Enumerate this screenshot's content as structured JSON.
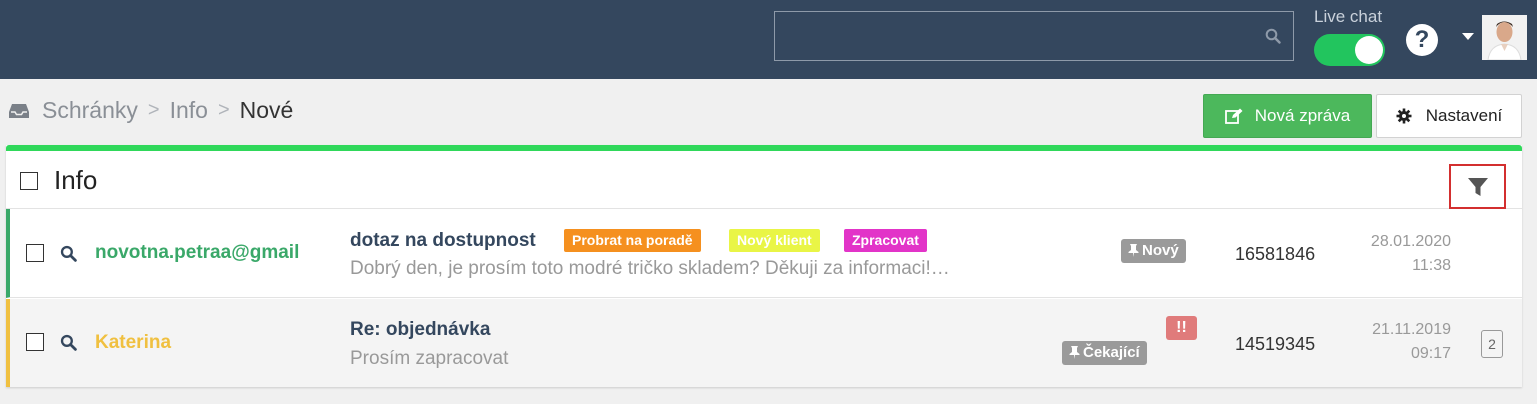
{
  "header": {
    "search_placeholder": "",
    "live_chat_label": "Live chat",
    "live_chat_on": true,
    "help_label": "?"
  },
  "breadcrumb": [
    "Schránky",
    "Info",
    "Nové"
  ],
  "toolbar": {
    "new_message_label": "Nová zpráva",
    "settings_label": "Nastavení"
  },
  "panel": {
    "title": "Info"
  },
  "messages": [
    {
      "sender": "novotna.petraa@gmail",
      "subject": "dotaz na dostupnost",
      "preview": "Dobrý den, je prosím toto modré tričko skladem?  Děkuji za informaci!…",
      "tags": [
        {
          "label": "Probrat na poradě",
          "color": "#f5901f"
        },
        {
          "label": "Nový klient",
          "color": "#e9f546"
        },
        {
          "label": "Zpracovat",
          "color": "#e234c8"
        }
      ],
      "status": "Nový",
      "id": "16581846",
      "date": "28.01.2020",
      "time": "11:38",
      "sender_color": "#3aa869"
    },
    {
      "sender": "Katerina",
      "subject": "Re: objednávka",
      "preview": "Prosím zapracovat",
      "urgent": "!!",
      "status": "Čekající",
      "id": "14519345",
      "date": "21.11.2019",
      "time": "09:17",
      "count": "2",
      "sender_color": "#f0c040"
    }
  ]
}
